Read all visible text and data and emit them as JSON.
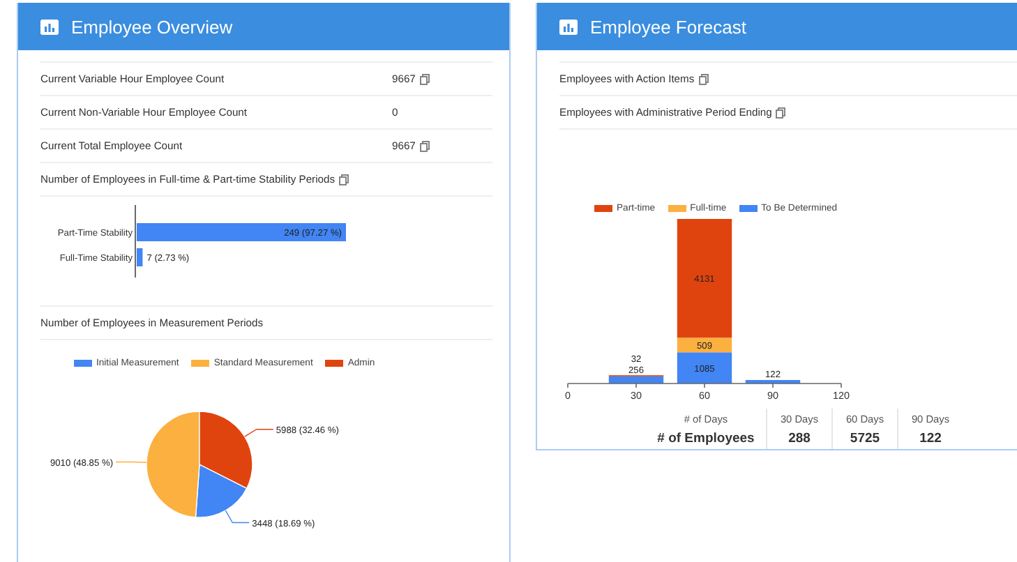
{
  "overview": {
    "title": "Employee Overview",
    "stats": [
      {
        "label": "Current Variable Hour Employee Count",
        "value": "9667",
        "details_icon": true
      },
      {
        "label": "Current Non-Variable Hour Employee Count",
        "value": "0",
        "details_icon": false
      },
      {
        "label": "Current Total Employee Count",
        "value": "9667",
        "details_icon": true
      }
    ],
    "stability": {
      "title": "Number of Employees in Full-time & Part-time Stability Periods",
      "details_icon": true,
      "chart_data": {
        "type": "bar",
        "orientation": "horizontal",
        "categories": [
          "Part-Time Stability",
          "Full-Time Stability"
        ],
        "values": [
          249,
          7
        ],
        "value_labels": [
          "249 (97.27 %)",
          "7 (2.73 %)"
        ]
      }
    },
    "measurement": {
      "title": "Number of Employees in Measurement Periods",
      "chart_data": {
        "type": "pie",
        "categories": [
          "Initial Measurement",
          "Standard Measurement",
          "Admin"
        ],
        "values": [
          3448,
          9010,
          5988
        ],
        "colors": [
          "#4285f4",
          "#fbb040",
          "#e0440e"
        ],
        "value_labels": [
          "3448 (18.69 %)",
          "9010 (48.85 %)",
          "5988 (32.46 %)"
        ]
      }
    }
  },
  "forecast": {
    "title": "Employee Forecast",
    "links": [
      {
        "label": "Employees with Action Items",
        "details_icon": true
      },
      {
        "label": "Employees with Administrative Period Ending",
        "details_icon": true
      }
    ],
    "chart_data": {
      "type": "bar",
      "stacked": true,
      "x": [
        30,
        60,
        90
      ],
      "xlim": [
        0,
        120
      ],
      "xticks": [
        0,
        30,
        60,
        90,
        120
      ],
      "data_labels": true,
      "series": [
        {
          "name": "Part-time",
          "color": "#e0440e",
          "values": [
            32,
            4131,
            null
          ]
        },
        {
          "name": "Full-time",
          "color": "#fbb040",
          "values": [
            null,
            509,
            null
          ]
        },
        {
          "name": "To Be Determined",
          "color": "#4285f4",
          "values": [
            256,
            1085,
            122
          ]
        }
      ]
    },
    "summary": {
      "days_label": "# of Days",
      "employees_label": "# of Employees",
      "columns": [
        {
          "days": "30 Days",
          "count": "288"
        },
        {
          "days": "60 Days",
          "count": "5725"
        },
        {
          "days": "90 Days",
          "count": "122"
        }
      ]
    }
  }
}
